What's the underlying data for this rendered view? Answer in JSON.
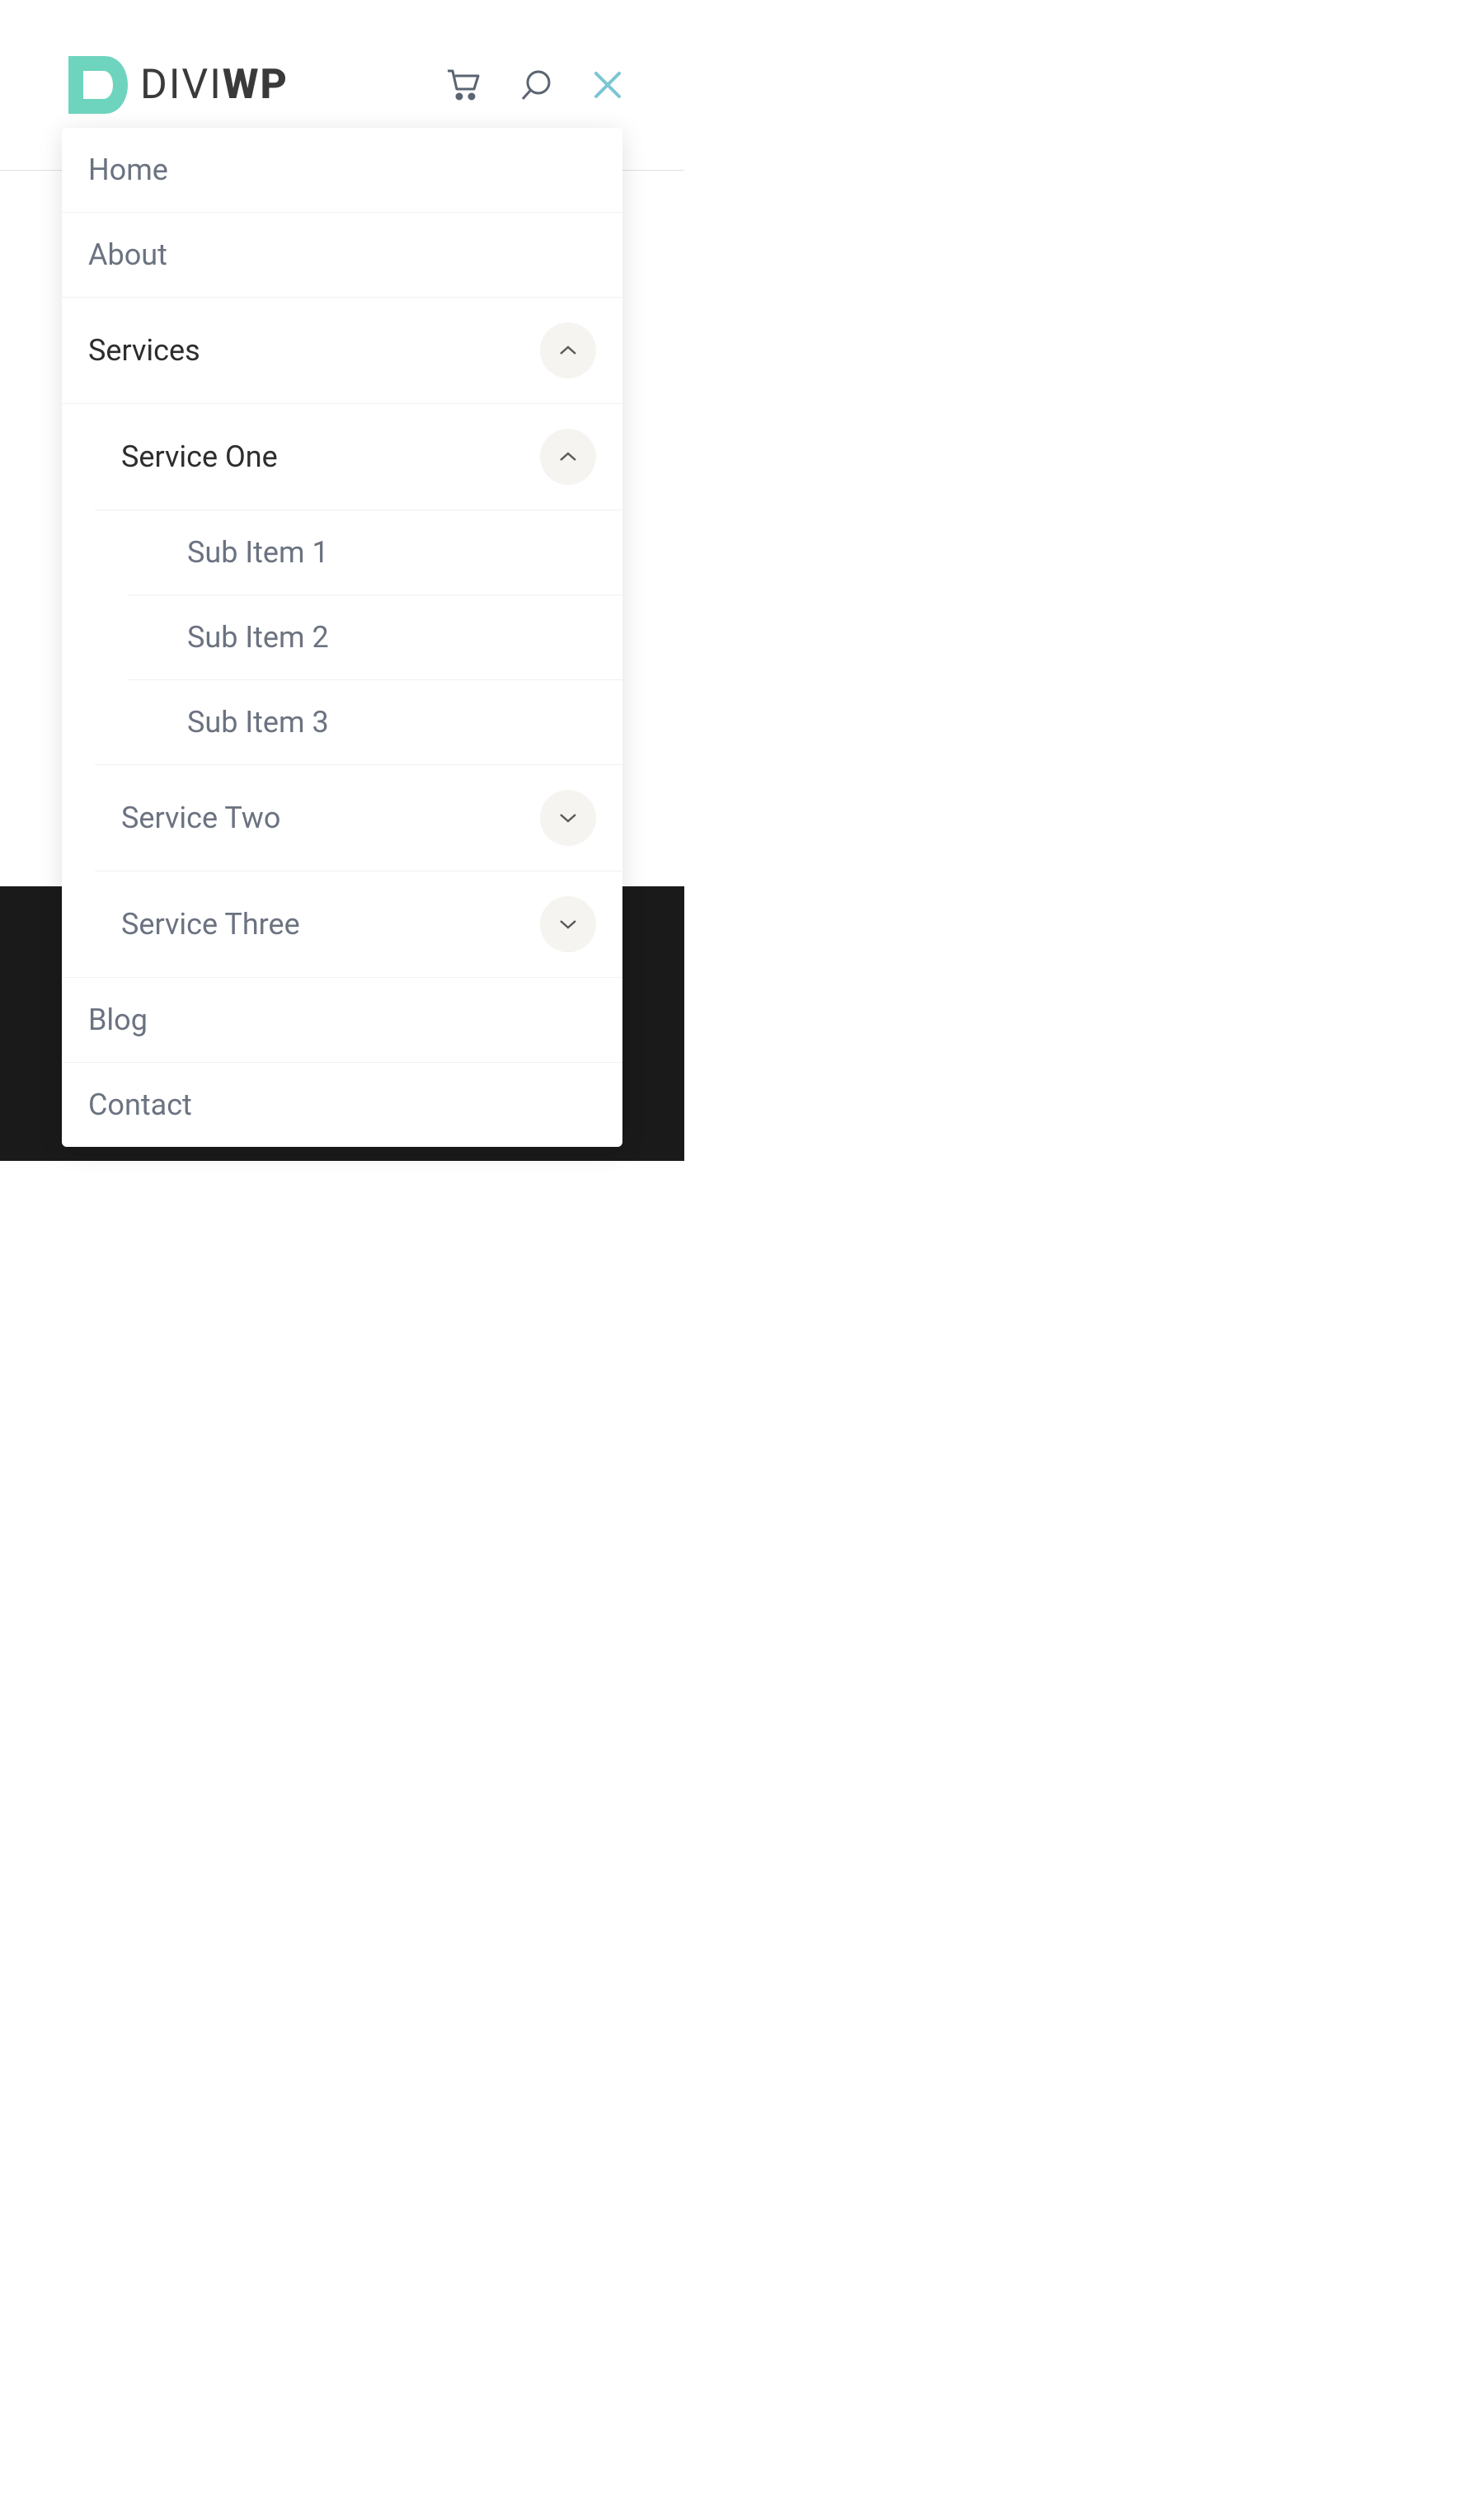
{
  "logo": {
    "text_prefix": "DIVI",
    "text_suffix": "WP",
    "accent_color": "#6fd4be"
  },
  "header": {
    "icons": {
      "cart": "cart-icon",
      "search": "search-icon",
      "close": "close-icon"
    }
  },
  "menu": {
    "items": [
      {
        "label": "Home",
        "active": false,
        "has_children": false
      },
      {
        "label": "About",
        "active": false,
        "has_children": false
      },
      {
        "label": "Services",
        "active": true,
        "has_children": true,
        "expanded": true,
        "children": [
          {
            "label": "Service One",
            "active": true,
            "has_children": true,
            "expanded": true,
            "children": [
              {
                "label": "Sub Item 1"
              },
              {
                "label": "Sub Item 2"
              },
              {
                "label": "Sub Item 3"
              }
            ]
          },
          {
            "label": "Service Two",
            "active": false,
            "has_children": true,
            "expanded": false
          },
          {
            "label": "Service Three",
            "active": false,
            "has_children": true,
            "expanded": false
          }
        ]
      },
      {
        "label": "Blog",
        "active": false,
        "has_children": false
      },
      {
        "label": "Contact",
        "active": false,
        "has_children": false
      }
    ]
  },
  "colors": {
    "accent": "#6fd4be",
    "text_muted": "#6b7280",
    "text_dark": "#2d2d2d",
    "toggle_bg": "#f5f4f0",
    "border": "#f0f0f0",
    "icon_close": "#7bc5d4"
  }
}
